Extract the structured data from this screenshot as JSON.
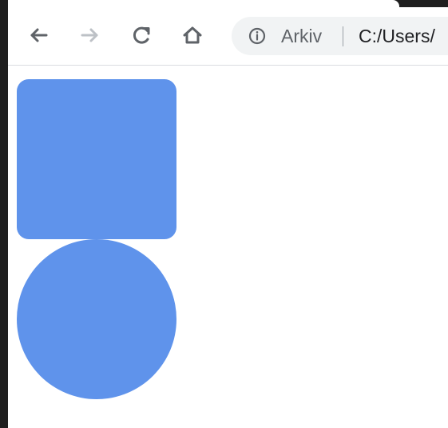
{
  "browser": {
    "address_bar": {
      "site_label": "Arkiv",
      "url": "C:/Users/"
    },
    "icons": {
      "back": "arrow-left-icon",
      "forward": "arrow-right-icon",
      "reload": "reload-icon",
      "home": "home-icon",
      "info": "info-icon"
    }
  },
  "page": {
    "shapes": [
      {
        "type": "rounded-square",
        "color": "#5f93eb"
      },
      {
        "type": "circle",
        "color": "#5f93eb"
      }
    ]
  }
}
